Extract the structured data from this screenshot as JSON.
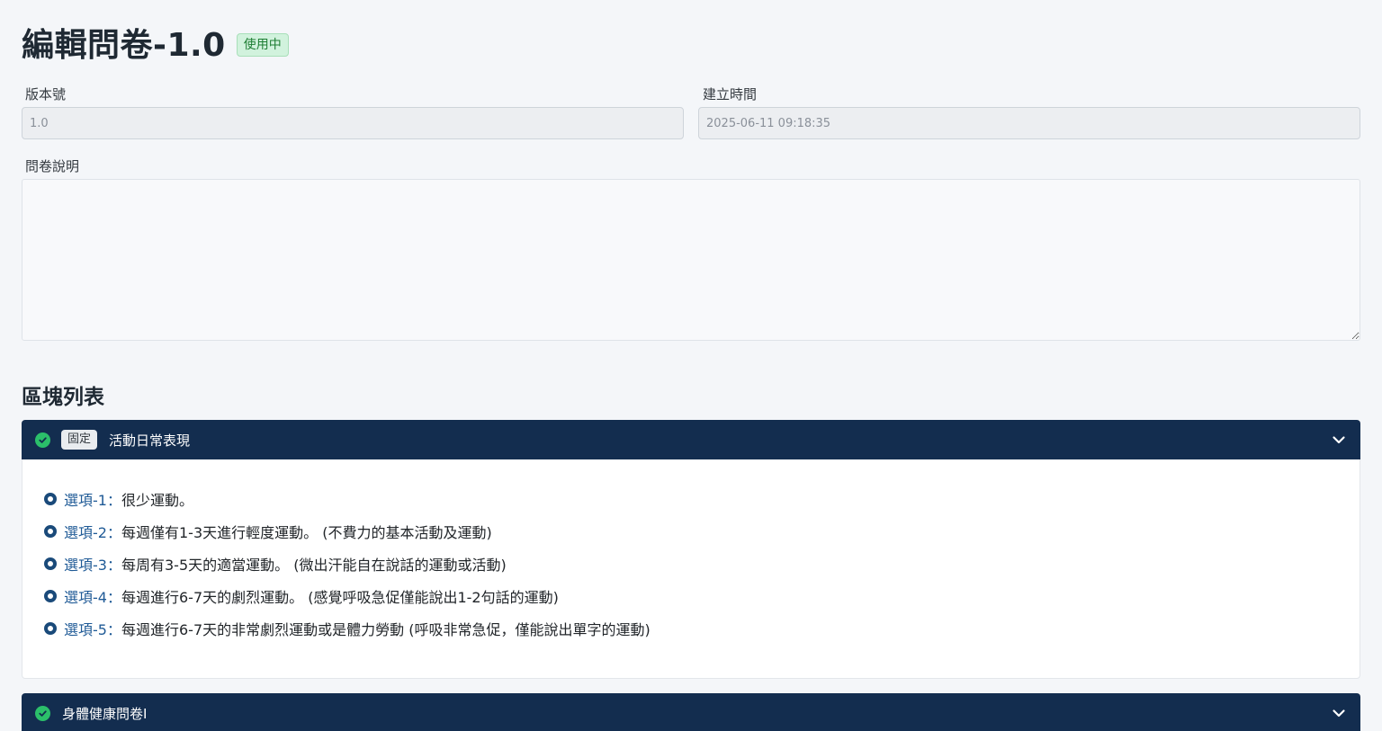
{
  "header": {
    "title": "編輯問卷-1.0",
    "status_badge": "使用中"
  },
  "form": {
    "version_label": "版本號",
    "version_value": "1.0",
    "created_label": "建立時間",
    "created_value": "2025-06-11 09:18:35",
    "description_label": "問卷說明",
    "description_value": ""
  },
  "blocks_section": {
    "title": "區塊列表",
    "blocks": [
      {
        "fixed_badge": "固定",
        "name": "活動日常表現",
        "expanded": true,
        "options": [
          {
            "key": "選項-1",
            "colon": "：",
            "text": "很少運動。"
          },
          {
            "key": "選項-2",
            "colon": "：",
            "text": "每週僅有1-3天進行輕度運動。 (不費力的基本活動及運動)"
          },
          {
            "key": "選項-3",
            "colon": "：",
            "text": "每周有3-5天的適當運動。 (微出汗能自在說話的運動或活動)"
          },
          {
            "key": "選項-4",
            "colon": "：",
            "text": "每週進行6-7天的劇烈運動。 (感覺呼吸急促僅能說出1-2句話的運動)"
          },
          {
            "key": "選項-5",
            "colon": "：",
            "text": "每週進行6-7天的非常劇烈運動或是體力勞動 (呼吸非常急促，僅能說出單字的運動)"
          }
        ]
      },
      {
        "name": "身體健康問卷I",
        "expanded": false
      }
    ]
  },
  "colors": {
    "header_bg": "#132d4f",
    "accent_check": "#2bbf6a",
    "option_key": "#1f5a96",
    "status_badge_bg": "#d1f2dd"
  }
}
